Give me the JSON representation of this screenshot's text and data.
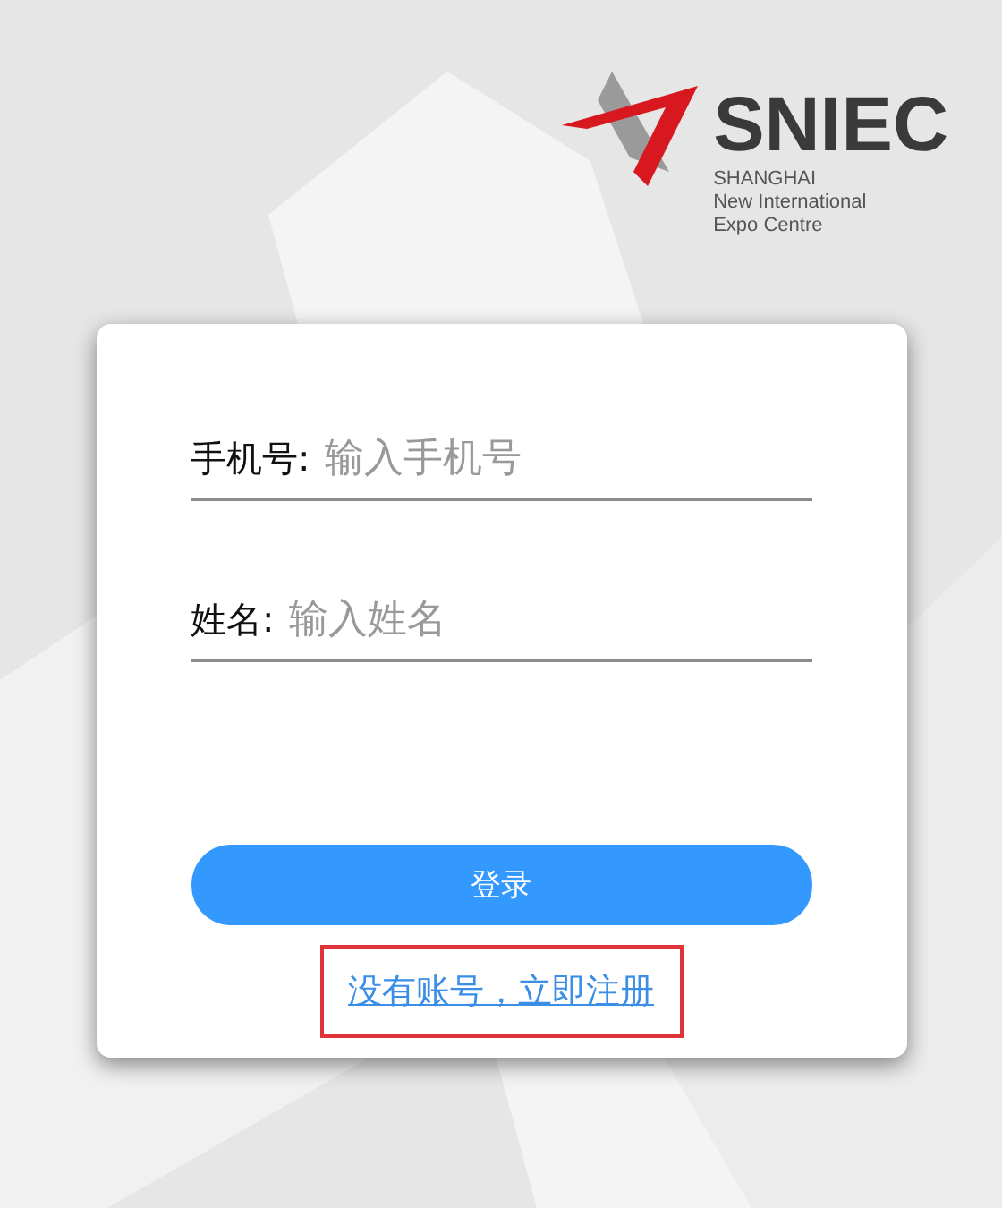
{
  "logo": {
    "name": "SNIEC",
    "lines": [
      "SHANGHAI",
      "New International",
      "Expo Centre"
    ]
  },
  "fields": [
    {
      "label": "手机号:",
      "placeholder": "输入手机号"
    },
    {
      "label": "姓名:",
      "placeholder": "输入姓名"
    }
  ],
  "login_button": {
    "label": "登录"
  },
  "register_link": {
    "label": "没有账号，立即注册",
    "highlighted": true
  }
}
